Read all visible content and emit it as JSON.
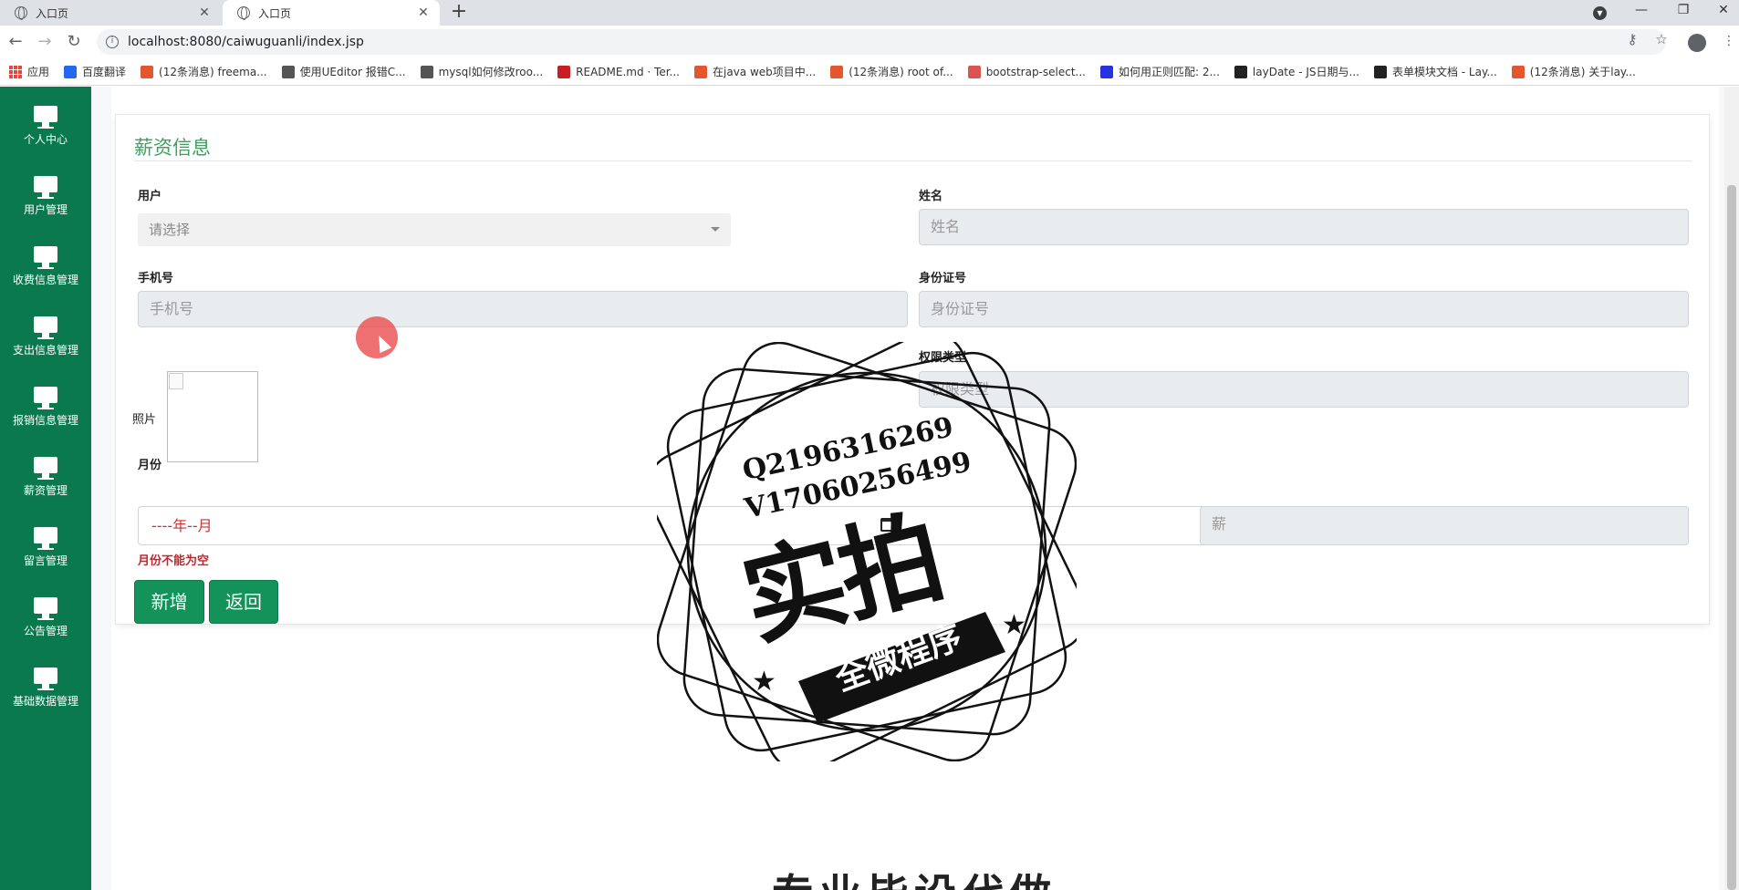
{
  "browser": {
    "tabs": [
      {
        "title": "入口页",
        "active": false
      },
      {
        "title": "入口页",
        "active": true
      }
    ],
    "url": "localhost:8080/caiwuguanli/index.jsp",
    "bookmarks": [
      {
        "label": "应用",
        "icon": "apps-icon",
        "color": "#e8453c"
      },
      {
        "label": "百度翻译",
        "icon": "translate-icon",
        "color": "#2468f2"
      },
      {
        "label": "(12条消息) freema...",
        "icon": "csdn-icon",
        "color": "#e4572e"
      },
      {
        "label": "使用UEditor 报错C...",
        "icon": "yuque-icon",
        "color": "#555555"
      },
      {
        "label": "mysql如何修改roo...",
        "icon": "yuque-icon",
        "color": "#555555"
      },
      {
        "label": "README.md · Ter...",
        "icon": "gitee-icon",
        "color": "#c71d23"
      },
      {
        "label": "在java web项目中...",
        "icon": "csdn-icon",
        "color": "#e4572e"
      },
      {
        "label": "(12条消息) root of...",
        "icon": "csdn-icon",
        "color": "#e4572e"
      },
      {
        "label": "bootstrap-select...",
        "icon": "site-icon",
        "color": "#d9534f"
      },
      {
        "label": "如何用正则匹配: 2...",
        "icon": "baidu-icon",
        "color": "#2932e1"
      },
      {
        "label": "layDate - JS日期与...",
        "icon": "layui-icon",
        "color": "#222222"
      },
      {
        "label": "表单模块文档 - Lay...",
        "icon": "layui-icon",
        "color": "#222222"
      },
      {
        "label": "(12条消息) 关于lay...",
        "icon": "csdn-icon",
        "color": "#e4572e"
      }
    ]
  },
  "sidebar": {
    "color": "#0a7a4e",
    "items": [
      {
        "label": "个人中心",
        "icon": "monitor-icon"
      },
      {
        "label": "用户管理",
        "icon": "monitor-icon"
      },
      {
        "label": "收费信息管理",
        "icon": "monitor-icon"
      },
      {
        "label": "支出信息管理",
        "icon": "monitor-icon"
      },
      {
        "label": "报销信息管理",
        "icon": "monitor-icon"
      },
      {
        "label": "薪资管理",
        "icon": "monitor-icon"
      },
      {
        "label": "留言管理",
        "icon": "monitor-icon"
      },
      {
        "label": "公告管理",
        "icon": "monitor-icon"
      },
      {
        "label": "基础数据管理",
        "icon": "monitor-icon"
      }
    ]
  },
  "form": {
    "title": "薪资信息",
    "fields": {
      "user": {
        "label": "用户",
        "placeholder": "请选择"
      },
      "name": {
        "label": "姓名",
        "placeholder": "姓名"
      },
      "phone": {
        "label": "手机号",
        "placeholder": "手机号"
      },
      "id_card": {
        "label": "身份证号",
        "placeholder": "身份证号"
      },
      "photo": {
        "label": "照片"
      },
      "role_type": {
        "label": "权限类型",
        "placeholder": "权限类型"
      },
      "month": {
        "label": "月份",
        "value": "----年--月",
        "error": "月份不能为空"
      },
      "salary": {
        "placeholder": "薪"
      }
    },
    "buttons": {
      "add": "新增",
      "back": "返回"
    }
  },
  "watermark": {
    "line1": "Q2196316269",
    "line2": "V17060256499",
    "big": "实拍",
    "ribbon": "全微程序"
  },
  "bottom_text": "专业毕设代做"
}
